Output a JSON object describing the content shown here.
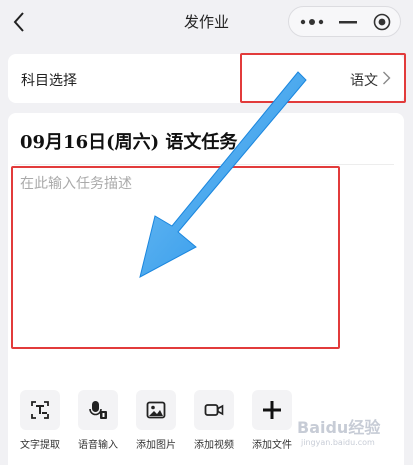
{
  "nav": {
    "title": "发作业"
  },
  "subject": {
    "label": "科目选择",
    "value": "语文"
  },
  "task": {
    "title": "09月16日(周六) 语文任务",
    "placeholder": "在此输入任务描述"
  },
  "tools": [
    {
      "label": "文字提取",
      "icon": "text-extract-icon"
    },
    {
      "label": "语音输入",
      "icon": "voice-input-icon"
    },
    {
      "label": "添加图片",
      "icon": "image-icon"
    },
    {
      "label": "添加视频",
      "icon": "video-icon"
    },
    {
      "label": "添加文件",
      "icon": "plus-icon"
    }
  ],
  "watermark": {
    "brand": "Baidu经验",
    "url": "jingyan.baidu.com"
  },
  "colors": {
    "highlight": "#e23b3b",
    "arrow": "#2b9bf0",
    "background": "#f1f1f4"
  }
}
